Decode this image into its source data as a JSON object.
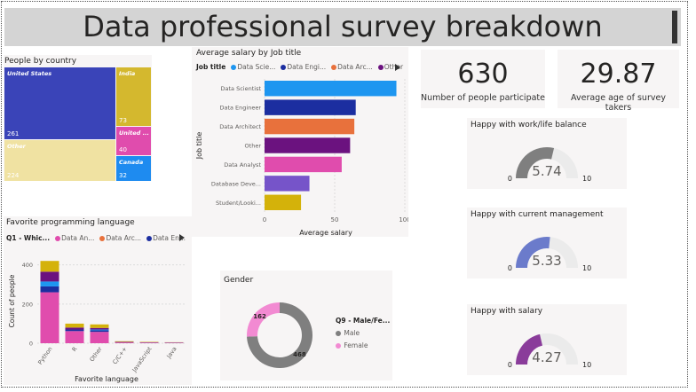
{
  "title": "Data professional survey breakdown",
  "country": {
    "title": "People by country",
    "tiles": [
      {
        "name": "United States",
        "value": "261",
        "color": "#3a44b8"
      },
      {
        "name": "India",
        "value": "73",
        "color": "#d4b82e"
      },
      {
        "name": "Other",
        "value": "224",
        "color": "#f0e2a2"
      },
      {
        "name": "United ...",
        "value": "40",
        "color": "#e04cad"
      },
      {
        "name": "Canada",
        "value": "32",
        "color": "#1e8bf0"
      }
    ]
  },
  "kpis": [
    {
      "value": "630",
      "label": "Number of people participate"
    },
    {
      "value": "29.87",
      "label": "Average age of survey takers"
    }
  ],
  "salary_legend": {
    "label": "Job title",
    "items": [
      "Data Scie...",
      "Data Engi...",
      "Data Arc...",
      "Other"
    ]
  },
  "language_legend": {
    "label": "Q1 - Whic...",
    "items": [
      "Data An...",
      "Data Arc...",
      "Data En..."
    ]
  },
  "gender_legend": {
    "label": "Q9 - Male/Fe..."
  },
  "gauges": [
    {
      "title": "Happy with work/life balance",
      "value": 5.74,
      "display": "5.74",
      "min": "0",
      "max": "10",
      "color": "#7f7f7f"
    },
    {
      "title": "Happy with current management",
      "value": 5.33,
      "display": "5.33",
      "min": "0",
      "max": "10",
      "color": "#6b7bcb"
    },
    {
      "title": "Happy with salary",
      "value": 4.27,
      "display": "4.27",
      "min": "0",
      "max": "10",
      "color": "#8a3c9a"
    }
  ],
  "chart_data": [
    {
      "type": "bar",
      "orientation": "horizontal",
      "title": "Average salary by Job title",
      "xlabel": "Average salary",
      "ylabel": "Job title",
      "categories": [
        "Data Scientist",
        "Data Engineer",
        "Data Architect",
        "Other",
        "Data Analyst",
        "Database Deve...",
        "Student/Looki..."
      ],
      "values": [
        94,
        65,
        64,
        61,
        55,
        32,
        26
      ],
      "colors": [
        "#1e96f0",
        "#1c2ea0",
        "#e8713c",
        "#6b127f",
        "#e04cad",
        "#7654c9",
        "#d4b20a"
      ],
      "xticks": [
        "0",
        "50",
        "100"
      ],
      "xlim": [
        0,
        100
      ],
      "grid": true
    },
    {
      "type": "bar",
      "stacked": true,
      "title": "Favorite programming language",
      "xlabel": "Favorite language",
      "ylabel": "Count of people",
      "categories": [
        "Python",
        "R",
        "Other",
        "C/C++",
        "JavaScript",
        "Java"
      ],
      "yticks": [
        "0",
        "200",
        "400"
      ],
      "ylim": [
        0,
        430
      ],
      "series": [
        {
          "name": "Data An...",
          "color": "#e04cad",
          "values": [
            260,
            62,
            58,
            4,
            3,
            2
          ]
        },
        {
          "name": "Data Arc...",
          "color": "#e8713c",
          "values": [
            0,
            0,
            0,
            0,
            0,
            0
          ]
        },
        {
          "name": "Data En...",
          "color": "#1c2ea0",
          "values": [
            30,
            8,
            8,
            1,
            1,
            1
          ]
        },
        {
          "color": "#1e96f0",
          "values": [
            25,
            0,
            4,
            0,
            0,
            0
          ]
        },
        {
          "color": "#6b127f",
          "values": [
            50,
            10,
            8,
            2,
            1,
            1
          ]
        },
        {
          "color": "#d4b20a",
          "values": [
            55,
            20,
            18,
            3,
            2,
            1
          ]
        }
      ],
      "grid": true
    },
    {
      "type": "pie",
      "donut": true,
      "title": "Gender",
      "slices": [
        {
          "name": "Male",
          "value": 468,
          "color": "#7f7f7f"
        },
        {
          "name": "Female",
          "value": 162,
          "color": "#f28ad2"
        }
      ]
    }
  ]
}
